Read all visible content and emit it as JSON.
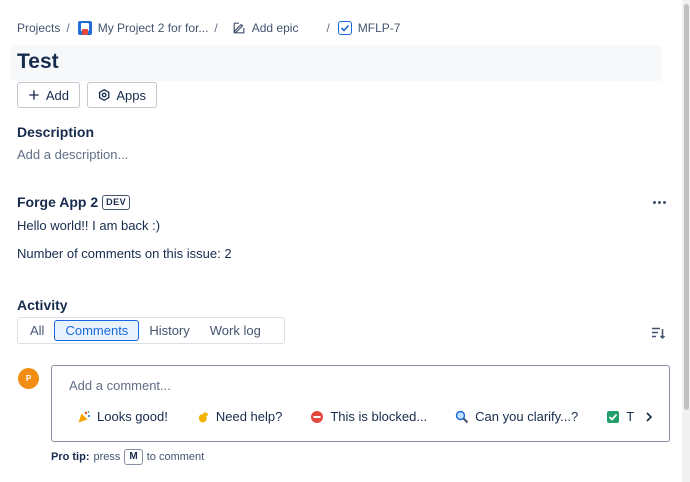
{
  "breadcrumb": {
    "projects": "Projects",
    "project": "My Project 2 for for...",
    "epic": "Add epic",
    "issue": "MFLP-7",
    "separator": "/"
  },
  "issue": {
    "title": "Test"
  },
  "toolbar": {
    "add_label": "Add",
    "apps_label": "Apps"
  },
  "description": {
    "heading": "Description",
    "placeholder": "Add a description..."
  },
  "forge_app": {
    "title": "Forge App 2",
    "badge": "DEV",
    "line1": "Hello world!! I am back :)",
    "line2": "Number of comments on this issue: 2"
  },
  "activity": {
    "heading": "Activity",
    "tabs": [
      {
        "label": "All",
        "active": false
      },
      {
        "label": "Comments",
        "active": true
      },
      {
        "label": "History",
        "active": false
      },
      {
        "label": "Work log",
        "active": false
      }
    ]
  },
  "comment": {
    "avatar_initial": "P",
    "placeholder": "Add a comment...",
    "quick_replies": [
      {
        "emoji": "party-popper-icon",
        "label": "Looks good!"
      },
      {
        "emoji": "waving-hand-icon",
        "label": "Need help?"
      },
      {
        "emoji": "no-entry-icon",
        "label": "This is blocked..."
      },
      {
        "emoji": "magnifier-icon",
        "label": "Can you clarify...?"
      },
      {
        "emoji": "check-box-icon",
        "label": "T"
      }
    ],
    "pro_tip_label": "Pro tip:",
    "pro_tip_press": "press",
    "pro_tip_key": "M",
    "pro_tip_suffix": "to comment"
  },
  "colors": {
    "accent": "#1868db",
    "avatar": "#f18d13",
    "text": "#172b4d"
  }
}
